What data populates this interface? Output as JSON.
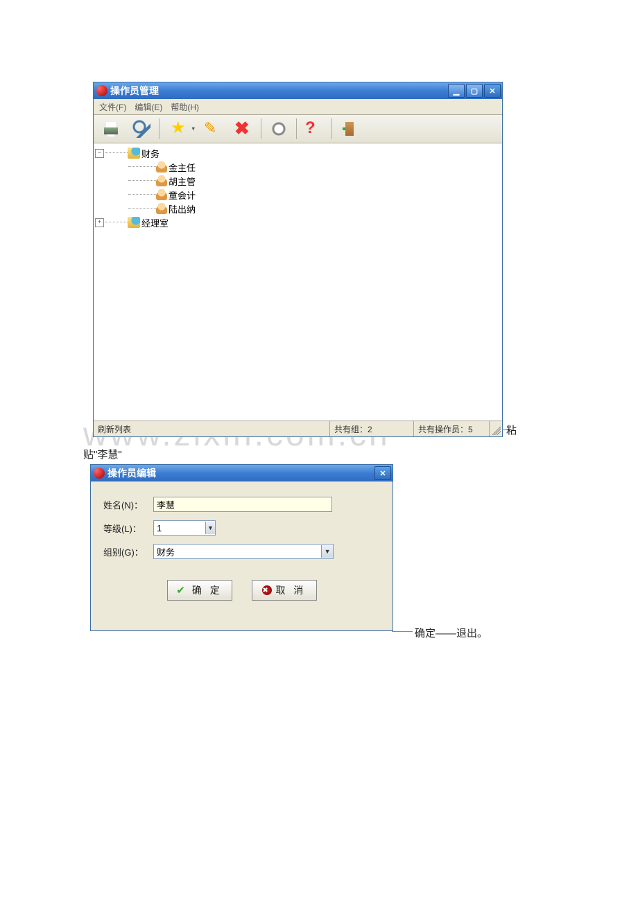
{
  "win1": {
    "title": "操作员管理",
    "menu": {
      "file": "文件(F)",
      "edit": "编辑(E)",
      "help": "帮助(H)"
    },
    "tree": {
      "dept1": {
        "label": "财务",
        "expanded": true,
        "children": [
          "金主任",
          "胡主管",
          "童会计",
          "陆出纳"
        ]
      },
      "dept2": {
        "label": "经理室",
        "expanded": false
      }
    },
    "status": {
      "refresh": "刷新列表",
      "groups": "共有组：2",
      "operators": "共有操作员：5"
    }
  },
  "win2": {
    "title": "操作员编辑",
    "labels": {
      "name": "姓名(N)：",
      "level": "等级(L)：",
      "group": "组别(G)："
    },
    "values": {
      "name": "李慧",
      "level": "1",
      "group": "财务"
    },
    "buttons": {
      "ok": "确 定",
      "cancel": "取 消"
    }
  },
  "annotations": {
    "a1a": "粘",
    "a1b": "贴\"李慧\"",
    "a2": "确定——退出。"
  },
  "watermark": "www.zixin.com.cn"
}
